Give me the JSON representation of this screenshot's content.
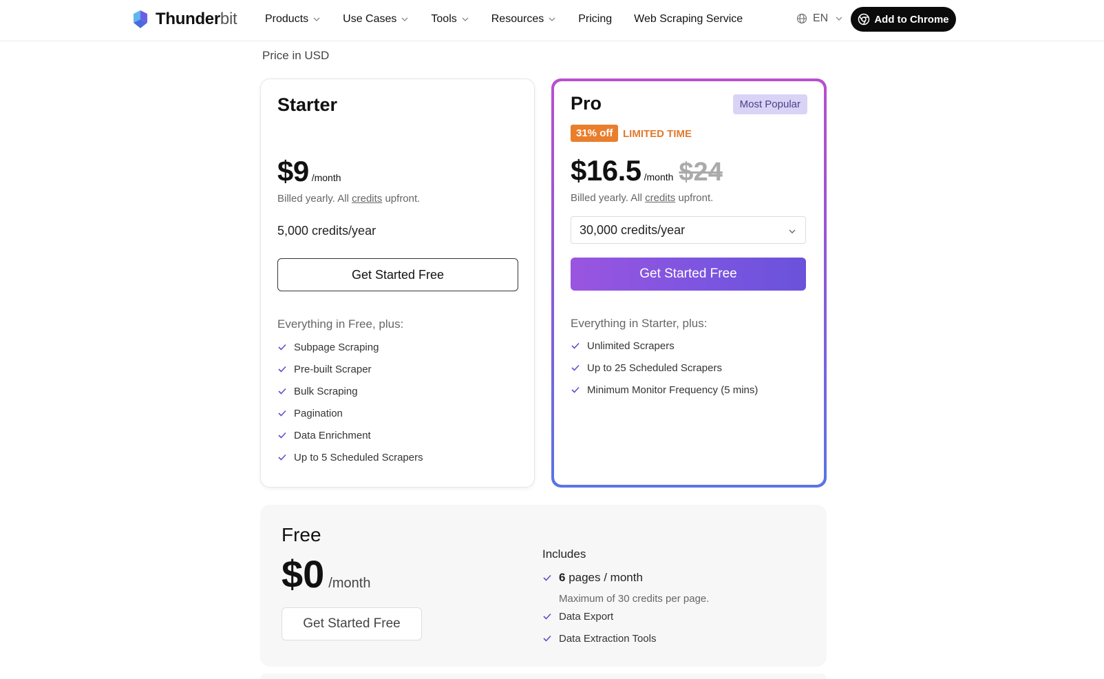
{
  "nav": {
    "logo_bold": "Thunder",
    "logo_light": "bit",
    "menu": [
      {
        "label": "Products",
        "has_dropdown": true
      },
      {
        "label": "Use Cases",
        "has_dropdown": true
      },
      {
        "label": "Tools",
        "has_dropdown": true
      },
      {
        "label": "Resources",
        "has_dropdown": true
      },
      {
        "label": "Pricing",
        "has_dropdown": false
      },
      {
        "label": "Web Scraping Service",
        "has_dropdown": false
      }
    ],
    "language": "EN",
    "cta": "Add to Chrome"
  },
  "price_in": "Price in USD",
  "starter": {
    "title": "Starter",
    "price": "$9",
    "per": "/month",
    "billed_prefix": "Billed yearly. All ",
    "billed_link": "credits",
    "billed_suffix": " upfront.",
    "credits": "5,000 credits/year",
    "button": "Get Started Free",
    "everything": "Everything in Free, plus:",
    "features": [
      "Subpage Scraping",
      "Pre-built Scraper",
      "Bulk Scraping",
      "Pagination",
      "Data Enrichment",
      "Up to 5 Scheduled Scrapers"
    ]
  },
  "pro": {
    "title": "Pro",
    "badge": "Most Popular",
    "discount": "31% off",
    "limited": "LIMITED TIME",
    "price": "$16.5",
    "per": "/month",
    "old_price": "$24",
    "billed_prefix": "Billed yearly. All ",
    "billed_link": "credits",
    "billed_suffix": " upfront.",
    "credits_selected": "30,000 credits/year",
    "button": "Get Started Free",
    "everything": "Everything in Starter, plus:",
    "features": [
      "Unlimited Scrapers",
      "Up to 25 Scheduled Scrapers",
      "Minimum Monitor Frequency (5 mins)"
    ]
  },
  "free": {
    "title": "Free",
    "price": "$0",
    "per": "/month",
    "button": "Get Started Free",
    "includes": "Includes",
    "pages_num": "6",
    "pages_text": " pages / month",
    "max_note": "Maximum of 30 credits per page.",
    "features": [
      "Data Export",
      "Data Extraction Tools"
    ]
  },
  "colors": {
    "accent_purple": "#7a55e0",
    "check": "#5b4fc9",
    "discount_orange": "#e97e2c"
  }
}
